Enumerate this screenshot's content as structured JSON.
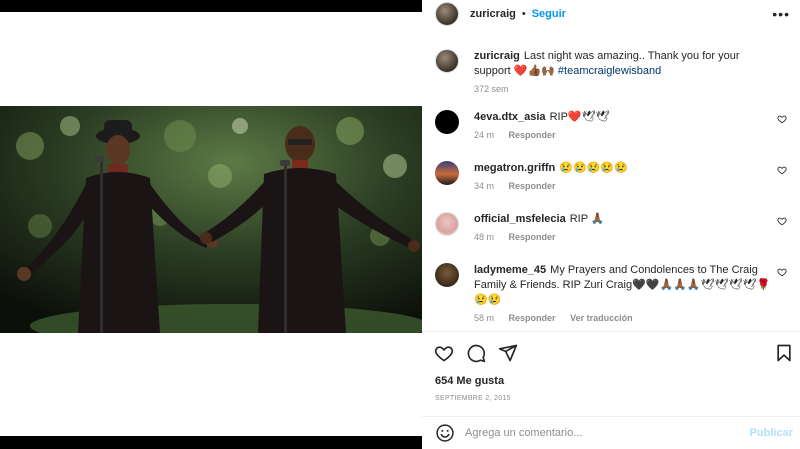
{
  "post": {
    "username": "zuricraig",
    "follow_label": "Seguir",
    "more_icon": "more-horizontal-icon"
  },
  "caption": {
    "username": "zuricraig",
    "text": "Last night was amazing.. Thank you for your support ❤️👍🏾🙌🏾",
    "hashtag": "#teamcraiglewisband",
    "age": "372 sem"
  },
  "comments": [
    {
      "username": "4eva.dtx_asia",
      "text": "RIP❤️🕊🕊",
      "age": "24 m",
      "reply_label": "Responder"
    },
    {
      "username": "megatron.griffn",
      "text": "😢😢😢😢😢",
      "age": "34 m",
      "reply_label": "Responder"
    },
    {
      "username": "official_msfelecia",
      "text": "RIP 🙏🏾",
      "age": "48 m",
      "reply_label": "Responder"
    },
    {
      "username": "ladymeme_45",
      "text": "My Prayers and Condolences to The Craig Family & Friends. RIP Zuri Craig🖤🖤🙏🏾🙏🏾🙏🏾🕊🕊🕊🕊🌹😢😢",
      "age": "58 m",
      "reply_label": "Responder",
      "translation_label": "Ver traducción"
    }
  ],
  "actions": {
    "likes": "654 Me gusta",
    "date": "SEPTIEMBRE 2, 2015"
  },
  "composer": {
    "placeholder": "Agrega un comentario...",
    "publish_label": "Publicar"
  },
  "colors": {
    "accent": "#0095f6",
    "publish_disabled": "#b2dffc",
    "like_red": "#ed4956"
  }
}
